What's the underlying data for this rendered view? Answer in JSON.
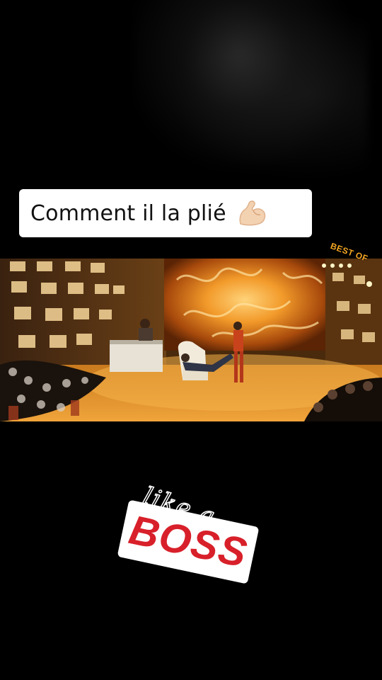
{
  "caption": {
    "text": "Comment il la plié",
    "emoji": "flexed-biceps-icon"
  },
  "video": {
    "watermark": "BEST OF"
  },
  "sticker": {
    "line1": "like a",
    "line2": "BOSS"
  },
  "colors": {
    "background": "#000000",
    "caption_bg": "#ffffff",
    "stage_orange": "#e8891c",
    "boss_red": "#d8202a"
  }
}
